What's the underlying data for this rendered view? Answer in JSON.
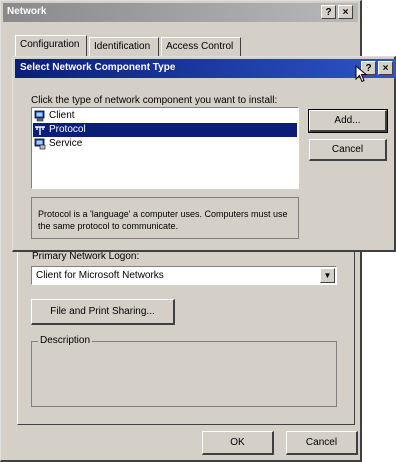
{
  "network_window": {
    "title": "Network",
    "help_glyph": "?",
    "close_glyph": "×",
    "tabs": [
      {
        "label": "Configuration"
      },
      {
        "label": "Identification"
      },
      {
        "label": "Access Control"
      }
    ],
    "primary_logon_label": "Primary Network Logon:",
    "primary_logon_value": "Client for Microsoft Networks",
    "dropdown_arrow": "▼",
    "file_print_sharing_label": "File and Print Sharing...",
    "description_legend": "Description",
    "ok_label": "OK",
    "cancel_label": "Cancel"
  },
  "dialog": {
    "title": "Select Network Component Type",
    "help_glyph": "?",
    "close_glyph": "×",
    "instruction": "Click the type of network component you want to install:",
    "components": [
      {
        "label": "Client",
        "icon": "client-icon",
        "selected": false
      },
      {
        "label": "Protocol",
        "icon": "protocol-icon",
        "selected": true
      },
      {
        "label": "Service",
        "icon": "service-icon",
        "selected": false
      }
    ],
    "add_label": "Add...",
    "cancel_label": "Cancel",
    "description_text": "Protocol is a 'language' a computer uses. Computers must use the same protocol to communicate."
  },
  "colors": {
    "dialog_title_active": "#0a1e78",
    "window_face": "#d4d0c8",
    "selection": "#0a1e78"
  }
}
